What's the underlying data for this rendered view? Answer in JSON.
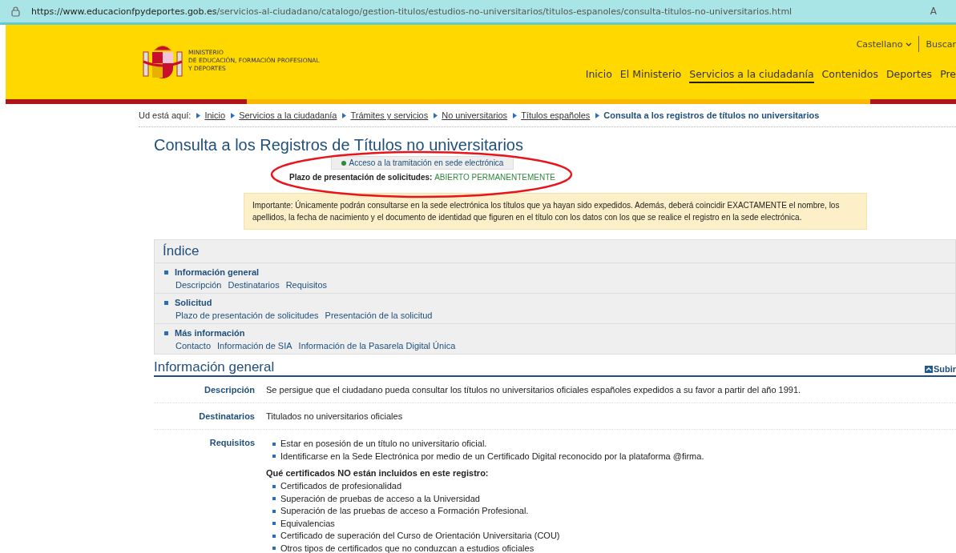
{
  "browser": {
    "url_host": "https://www.educacionfpydeportes.gob.es",
    "url_path": "/servicios-al-ciudadano/catalogo/gestion-titulos/estudios-no-universitarios/titulos-espanoles/consulta-titulos-no-universitarios.html",
    "read_aloud": "A"
  },
  "header": {
    "ministry_lines": [
      "MINISTERIO",
      "DE EDUCACIÓN, FORMACIÓN PROFESIONAL",
      "Y DEPORTES"
    ],
    "language": "Castellano",
    "search": "Buscar",
    "nav": [
      {
        "label": "Inicio",
        "selected": false
      },
      {
        "label": "El Ministerio",
        "selected": false
      },
      {
        "label": "Servicios a la ciudadanía",
        "selected": true
      },
      {
        "label": "Contenidos",
        "selected": false
      },
      {
        "label": "Deportes",
        "selected": false
      },
      {
        "label": "Pre",
        "selected": false
      }
    ]
  },
  "breadcrumb": {
    "prefix": "Ud está aquí:",
    "links": [
      "Inicio",
      "Servicios a la ciudadanía",
      "Trámites y servicios",
      "No universitarios",
      "Títulos españoles"
    ],
    "current": "Consulta a los registros de títulos no universitarios"
  },
  "page_title": "Consulta a los Registros de Títulos no universitarios",
  "access_button": "Acceso a la tramitación en sede electrónica",
  "deadline": {
    "label": "Plazo de presentación de solicitudes:",
    "value": "ABIERTO PERMANENTEMENTE"
  },
  "highlighted": true,
  "notice": "Importante: Únicamente podrán consultarse en la sede electrónica los títulos que ya hayan sido expedidos. Además, deberá coincidir EXACTAMENTE el nombre, los apellidos, la fecha de nacimiento y el documento de identidad que figuren en el título con los datos con los que se realice el registro en la sede electrónica.",
  "index": {
    "title": "Índice",
    "sections": [
      {
        "heading": "Información general",
        "links": [
          "Descripción",
          "Destinatarios",
          "Requisitos"
        ]
      },
      {
        "heading": "Solicitud",
        "links": [
          "Plazo de presentación de solicitudes",
          "Presentación de la solicitud"
        ]
      },
      {
        "heading": "Más información",
        "links": [
          "Contacto",
          "Información de SIA",
          "Información de la Pasarela Digital Única"
        ]
      }
    ]
  },
  "general": {
    "title": "Información general",
    "up_link": "Subir",
    "rows": [
      {
        "label": "Descripción",
        "kind": "text",
        "text": "Se persigue que el ciudadano pueda consultar los títulos no universitarios oficiales españoles expedidos a su favor a partir del año 1991."
      },
      {
        "label": "Destinatarios",
        "kind": "text",
        "text": "Titulados no universitarios oficiales"
      },
      {
        "label": "Requisitos",
        "kind": "lists",
        "items": [
          "Estar en posesión de un título no universitario oficial.",
          "Identificarse en la Sede Electrónica por medio de un Certificado Digital reconocido por la plataforma @firma."
        ],
        "subheading": "Qué certificados NO están incluidos en este registro:",
        "subitems": [
          "Certificados de profesionalidad",
          "Superación de pruebas de acceso a la Universidad",
          "Superación de las pruebas de acceso a Formación Profesional.",
          "Equivalencias",
          "Certificado de superación del Curso de Orientación Universitaria (COU)",
          "Otros tipos de certificados que no conduzcan a estudios oficiales"
        ]
      }
    ]
  }
}
